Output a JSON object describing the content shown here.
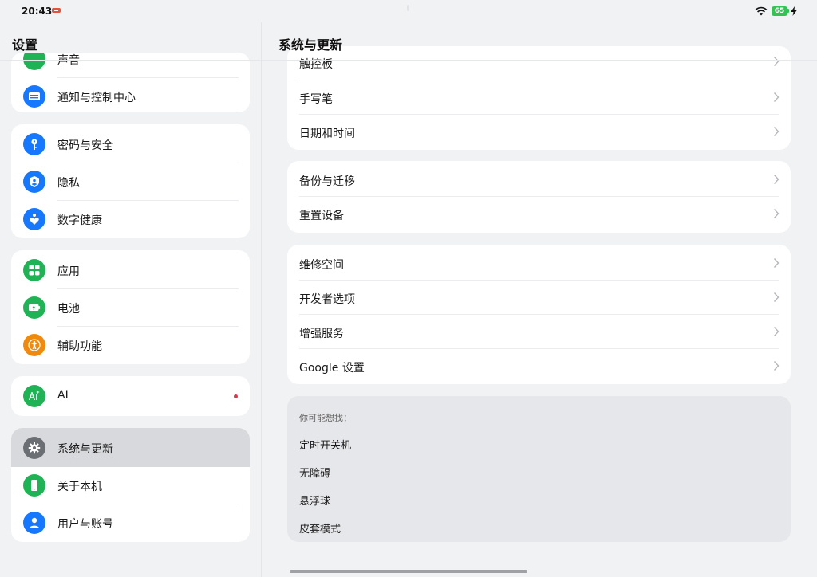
{
  "status": {
    "time": "20:43",
    "battery": "65"
  },
  "left": {
    "title": "设置",
    "partial_label": "声音",
    "groups": [
      {
        "items": [
          {
            "label": "通知与控制中心",
            "icon": "notification-icon",
            "color": "#1677ff"
          }
        ]
      },
      {
        "items": [
          {
            "label": "密码与安全",
            "icon": "key-icon",
            "color": "#1677ff"
          },
          {
            "label": "隐私",
            "icon": "privacy-shield-icon",
            "color": "#1677ff"
          },
          {
            "label": "数字健康",
            "icon": "digital-health-icon",
            "color": "#1677ff"
          }
        ]
      },
      {
        "items": [
          {
            "label": "应用",
            "icon": "apps-grid-icon",
            "color": "#1fb356"
          },
          {
            "label": "电池",
            "icon": "battery-icon",
            "color": "#1fb356"
          },
          {
            "label": "辅助功能",
            "icon": "accessibility-icon",
            "color": "#f08a0e"
          }
        ]
      },
      {
        "items": [
          {
            "label": "AI",
            "icon": "ai-sparkle-icon",
            "color": "#1fb356",
            "badge": true
          }
        ]
      },
      {
        "items": [
          {
            "label": "系统与更新",
            "icon": "gear-icon",
            "color": "#6b6e73",
            "selected": true
          },
          {
            "label": "关于本机",
            "icon": "phone-icon",
            "color": "#1fb356"
          },
          {
            "label": "用户与账号",
            "icon": "user-icon",
            "color": "#1677ff"
          }
        ]
      }
    ]
  },
  "right": {
    "title": "系统与更新",
    "groups": [
      {
        "items": [
          {
            "label": "触控板"
          },
          {
            "label": "手写笔"
          },
          {
            "label": "日期和时间"
          }
        ]
      },
      {
        "items": [
          {
            "label": "备份与迁移"
          },
          {
            "label": "重置设备"
          }
        ]
      },
      {
        "items": [
          {
            "label": "维修空间"
          },
          {
            "label": "开发者选项"
          },
          {
            "label": "增强服务"
          },
          {
            "label": "Google 设置"
          }
        ]
      }
    ],
    "suggestions": {
      "title": "你可能想找：",
      "items": [
        "定时开关机",
        "无障碍",
        "悬浮球",
        "皮套模式"
      ]
    }
  }
}
